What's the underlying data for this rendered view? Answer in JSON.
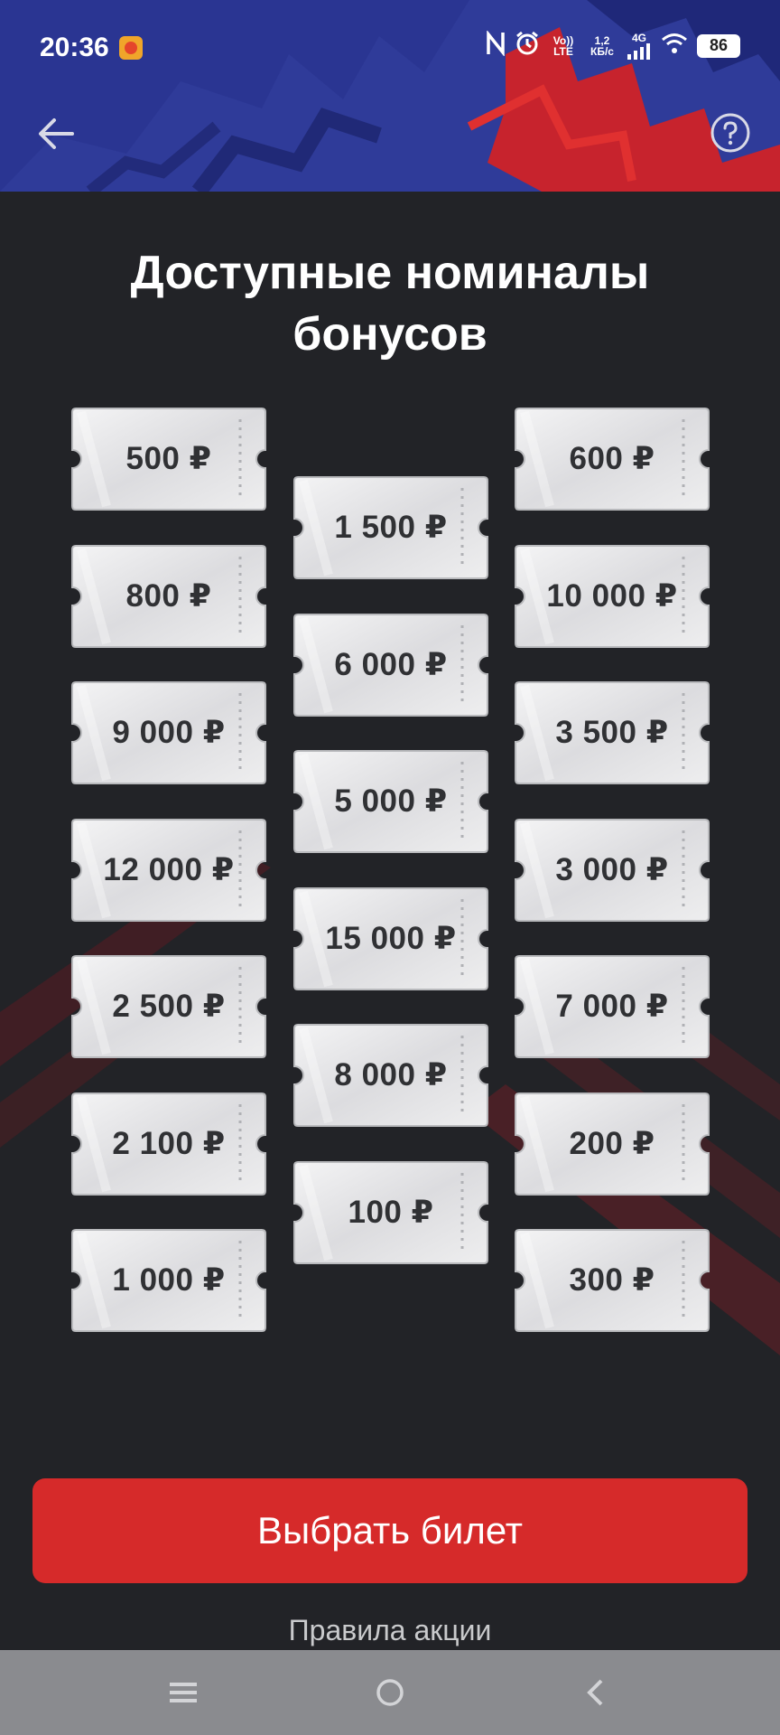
{
  "status_bar": {
    "time": "20:36",
    "volte": "Vo)) LTE",
    "speed": "1,2 КБ/с",
    "network": "4G",
    "battery": "86"
  },
  "header": {
    "back_icon": "arrow-left-icon",
    "help_icon": "question-circle-icon",
    "colors": {
      "band": "#2a3592",
      "accent": "#d62a2a"
    }
  },
  "title": {
    "line1": "Доступные номиналы",
    "line2": "бонусов"
  },
  "tickets": {
    "left": [
      "500 ₽",
      "800 ₽",
      "9 000 ₽",
      "12 000 ₽",
      "2 500 ₽",
      "2 100 ₽",
      "1 000 ₽"
    ],
    "middle": [
      "1 500 ₽",
      "6 000 ₽",
      "5 000 ₽",
      "15 000 ₽",
      "8 000 ₽",
      "100 ₽"
    ],
    "right": [
      "600 ₽",
      "10 000 ₽",
      "3 500 ₽",
      "3 000 ₽",
      "7 000 ₽",
      "200 ₽",
      "300 ₽"
    ]
  },
  "cta": {
    "label": "Выбрать билет"
  },
  "rules_link": "Правила акции",
  "nav": {
    "menu_icon": "menu-icon",
    "home_icon": "home-circle-icon",
    "back_icon": "back-chevron-icon"
  }
}
